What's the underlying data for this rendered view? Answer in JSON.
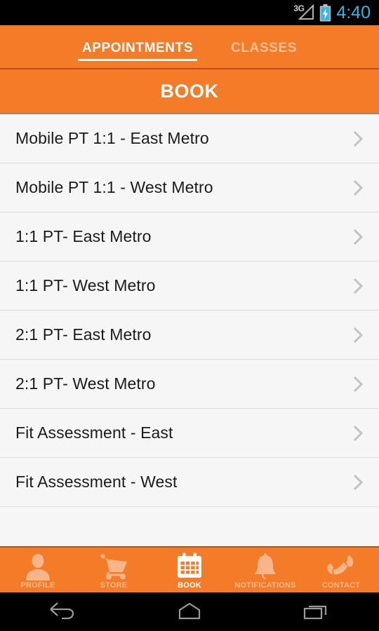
{
  "status_bar": {
    "network_label": "3G",
    "signal_icon": "signal-triangle-icon",
    "battery_icon": "battery-charging-icon",
    "time": "4:40",
    "time_color": "#33b5e5"
  },
  "tabs": {
    "items": [
      {
        "label": "APPOINTMENTS",
        "active": true
      },
      {
        "label": "CLASSES",
        "active": false
      }
    ]
  },
  "header": {
    "title": "BOOK"
  },
  "list": {
    "items": [
      {
        "label": "Mobile PT 1:1 - East Metro",
        "chevron": "chevron-right-icon"
      },
      {
        "label": "Mobile PT 1:1 - West Metro",
        "chevron": "chevron-right-icon"
      },
      {
        "label": "1:1 PT- East Metro",
        "chevron": "chevron-right-icon"
      },
      {
        "label": "1:1 PT- West Metro",
        "chevron": "chevron-right-icon"
      },
      {
        "label": "2:1 PT- East Metro",
        "chevron": "chevron-right-icon"
      },
      {
        "label": "2:1 PT- West Metro",
        "chevron": "chevron-right-icon"
      },
      {
        "label": "Fit Assessment - East",
        "chevron": "chevron-right-icon"
      },
      {
        "label": "Fit Assessment - West",
        "chevron": "chevron-right-icon"
      }
    ]
  },
  "bottom_nav": {
    "items": [
      {
        "label": "PROFILE",
        "icon": "person-icon",
        "active": false
      },
      {
        "label": "STORE",
        "icon": "cart-icon",
        "active": false
      },
      {
        "label": "BOOK",
        "icon": "calendar-icon",
        "active": true
      },
      {
        "label": "NOTIFICATIONS",
        "icon": "bell-icon",
        "active": false
      },
      {
        "label": "CONTACT",
        "icon": "phone-icon",
        "active": false
      }
    ]
  },
  "system_nav": {
    "items": [
      {
        "label": "Back",
        "icon": "back-arrow-icon"
      },
      {
        "label": "Home",
        "icon": "home-icon"
      },
      {
        "label": "Recents",
        "icon": "recents-icon"
      }
    ]
  },
  "colors": {
    "brand_orange": "#F47B28",
    "brand_orange_dark": "#b8501a",
    "icon_inactive": "#f7b58a",
    "icon_active": "#ffffff",
    "list_background": "#f6f6f6",
    "list_divider": "#dcdcdc",
    "text_primary": "#1b1b1b"
  }
}
